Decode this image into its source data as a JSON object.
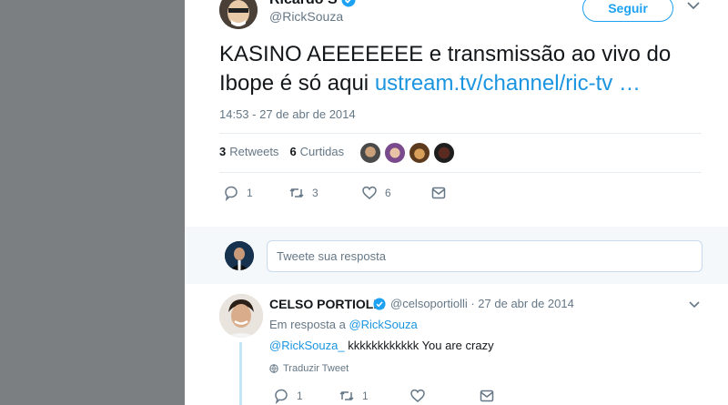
{
  "tweet": {
    "author_name": "Ricardo S",
    "author_handle": "@RickSouza",
    "follow_label": "Seguir",
    "text_main": "KASINO AEEEEEEE e transmissão ao vivo do Ibope é só aqui",
    "text_link": "ustream.tv/channel/ric-tv …",
    "timestamp": "14:53 - 27 de abr de 2014",
    "retweets_count": "3",
    "retweets_label": "Retweets",
    "likes_count": "6",
    "likes_label": "Curtidas",
    "reply_count": "1",
    "retweet_action_count": "3",
    "like_action_count": "6"
  },
  "composer": {
    "placeholder": "Tweete sua resposta"
  },
  "reply": {
    "author_name": "CELSO PORTIOLLI",
    "author_handle": "@celsoportiolli",
    "separator": " · ",
    "date": "27 de abr de 2014",
    "in_reply_prefix": "Em resposta a ",
    "in_reply_handle": "@RickSouza",
    "mention": "@RickSouza_",
    "text": " kkkkkkkkkkkk You are crazy",
    "translate_label": "Traduzir Tweet",
    "reply_count": "1",
    "retweet_count": "1"
  },
  "colors": {
    "accent": "#1da1f2",
    "link": "#1b95e0",
    "muted": "#657786",
    "backdrop": "#7b7f82"
  },
  "icons": [
    "verified-icon",
    "chevron-down-icon",
    "reply-icon",
    "retweet-icon",
    "like-icon",
    "dm-icon",
    "globe-icon"
  ]
}
